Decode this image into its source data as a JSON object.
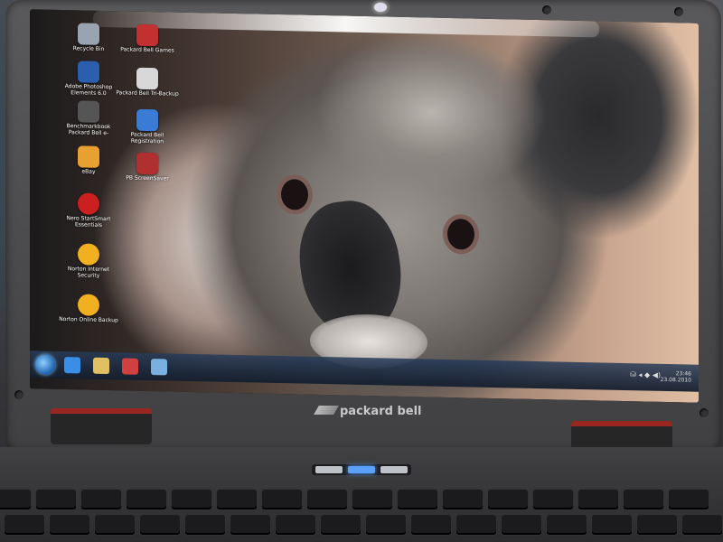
{
  "desktop": {
    "icons": [
      {
        "label": "Recycle Bin",
        "color": "#9aa4b0"
      },
      {
        "label": "Packard Bell Games",
        "color": "#c23030"
      },
      {
        "label": "Adobe Photoshop Elements 6.0",
        "color": "#2b5fae"
      },
      {
        "label": "Packard Bell Tri-Backup",
        "color": "#d8d8d8"
      },
      {
        "label": "Benchmarkbook Packard Bell e-",
        "color": "#555555"
      },
      {
        "label": "Packard Bell Registration",
        "color": "#3a7bd5"
      },
      {
        "label": "eBay",
        "color": "#e8a030"
      },
      {
        "label": "PB ScreenSaver",
        "color": "#b03030"
      },
      {
        "label": "Nero StartSmart Essentials",
        "color": "#cc2020"
      },
      {
        "label": "Norton Internet Security",
        "color": "#f0b020"
      },
      {
        "label": "Norton Online Backup",
        "color": "#f0b020"
      }
    ]
  },
  "taskbar": {
    "pinned": [
      {
        "name": "ie",
        "color": "#3a8ee6"
      },
      {
        "name": "folder",
        "color": "#e0c060"
      },
      {
        "name": "media",
        "color": "#d04040"
      },
      {
        "name": "pen",
        "color": "#7ab0e0"
      }
    ],
    "tray_time": "23:46",
    "tray_date": "23.08.2010",
    "tray_icons": "⛁ ◂ ◆ ◀)"
  },
  "brand": "packard bell"
}
